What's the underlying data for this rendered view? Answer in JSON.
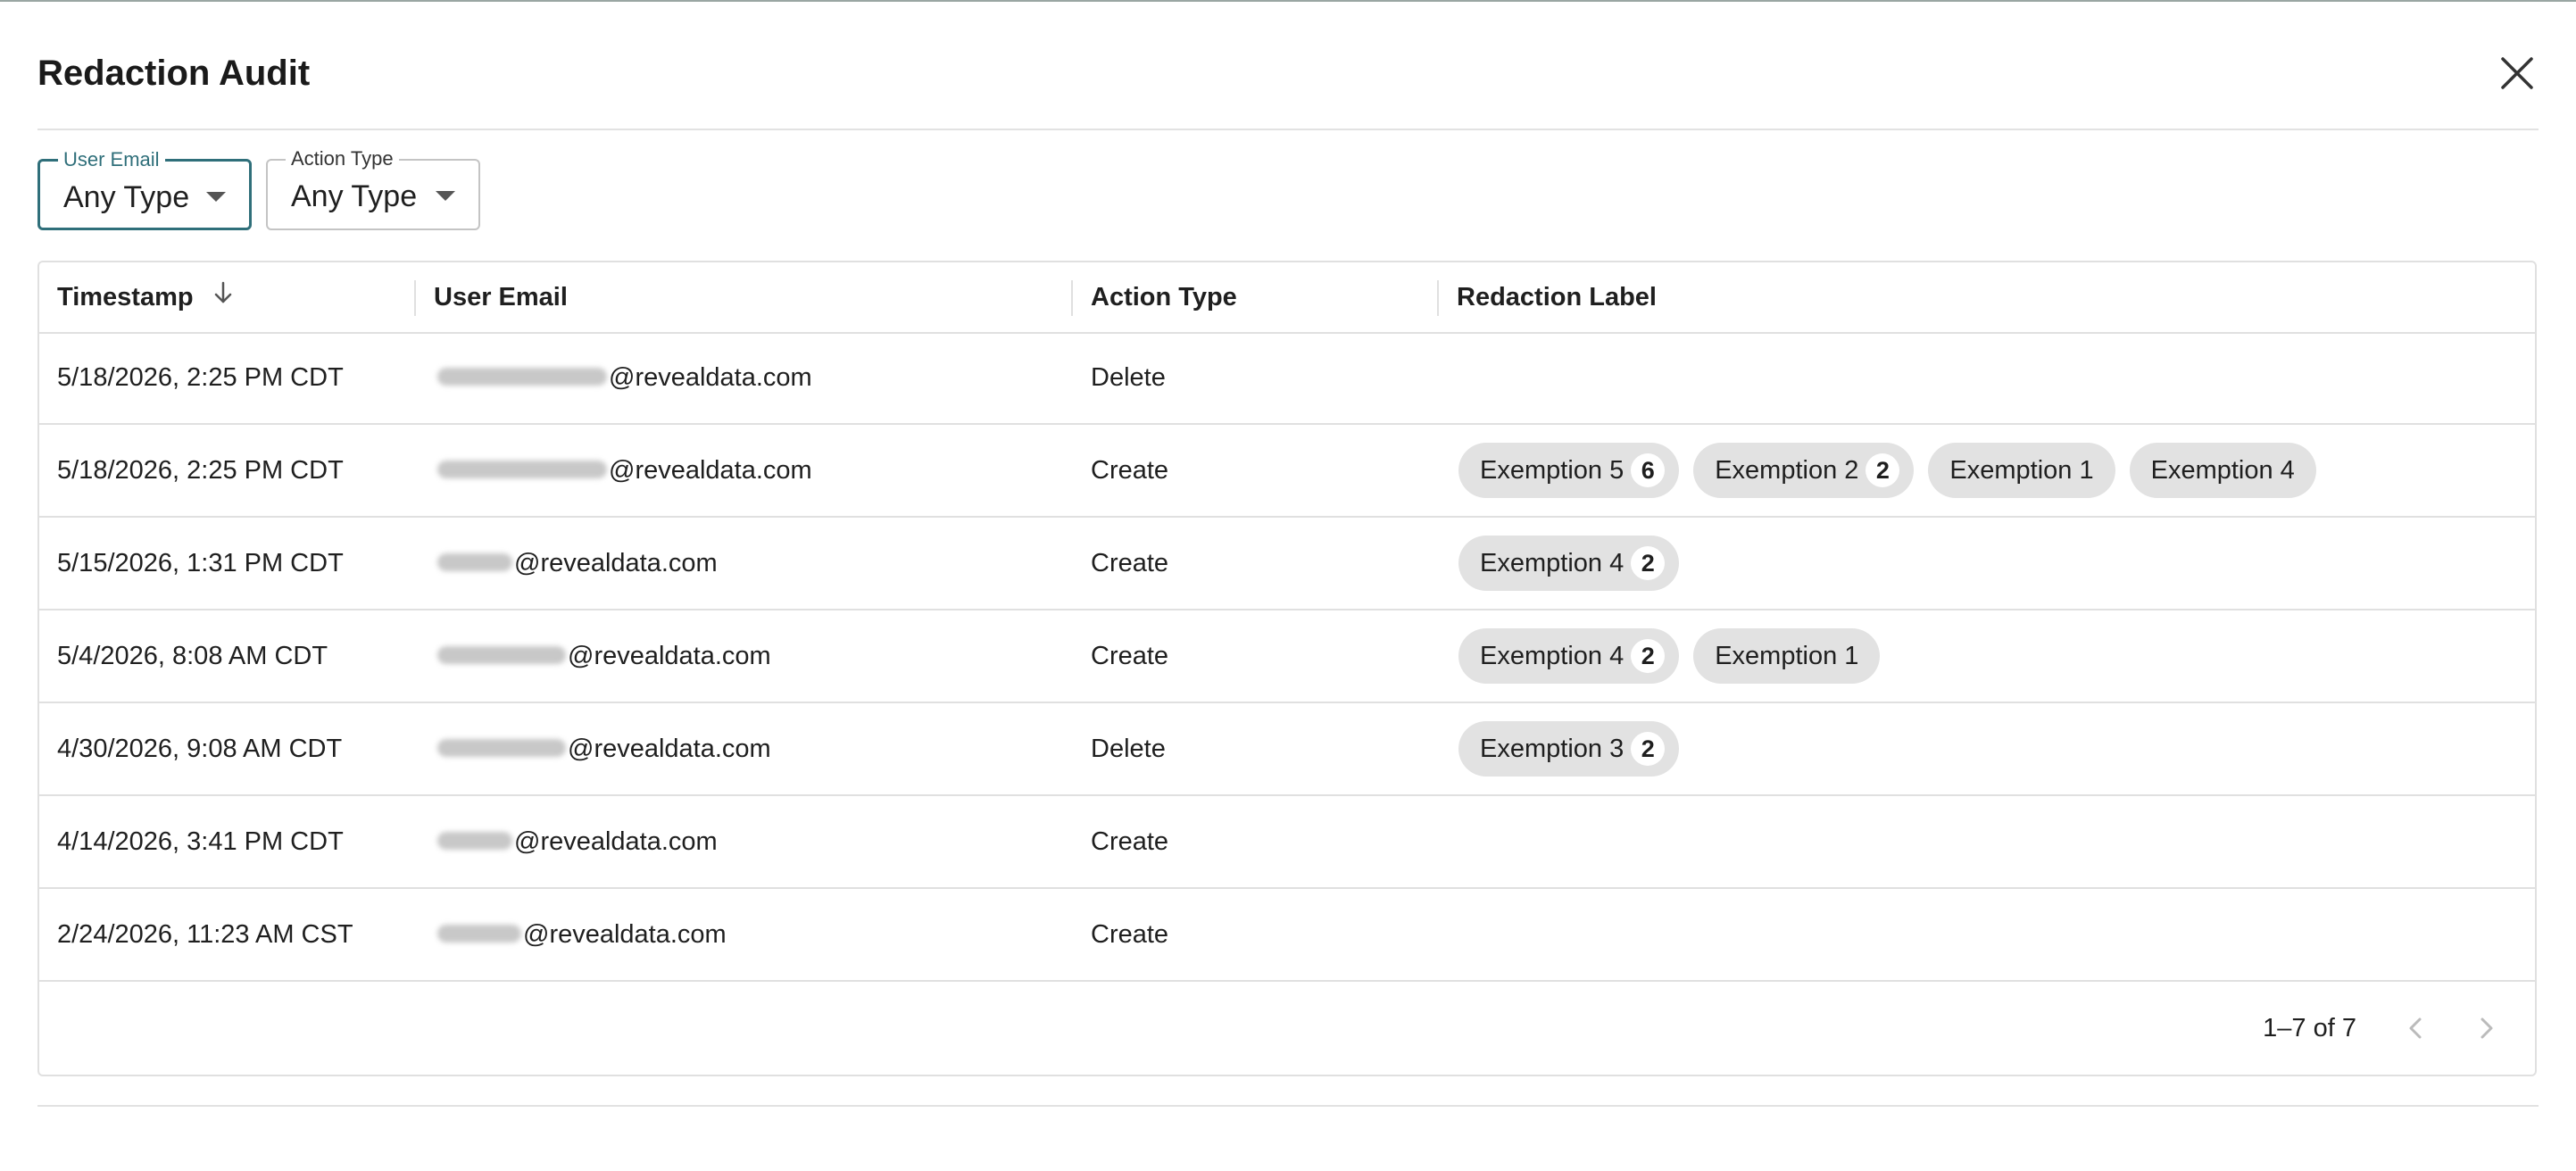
{
  "dialog": {
    "title": "Redaction Audit",
    "close_icon": "close-icon"
  },
  "filters": {
    "user_email": {
      "label": "User Email",
      "value": "Any Type"
    },
    "action_type": {
      "label": "Action Type",
      "value": "Any Type"
    }
  },
  "columns": {
    "timestamp": "Timestamp",
    "user_email": "User Email",
    "action_type": "Action Type",
    "redaction_label": "Redaction Label"
  },
  "rows": [
    {
      "timestamp": "5/18/2026, 2:25 PM CDT",
      "email_domain": "@revealdata.com",
      "action": "Delete",
      "labels": []
    },
    {
      "timestamp": "5/18/2026, 2:25 PM CDT",
      "email_domain": "@revealdata.com",
      "action": "Create",
      "labels": [
        {
          "text": "Exemption 5",
          "count": "6"
        },
        {
          "text": "Exemption 2",
          "count": "2"
        },
        {
          "text": "Exemption 1",
          "count": ""
        },
        {
          "text": "Exemption 4",
          "count": ""
        }
      ]
    },
    {
      "timestamp": "5/15/2026, 1:31 PM CDT",
      "email_domain": "@revealdata.com",
      "action": "Create",
      "labels": [
        {
          "text": "Exemption 4",
          "count": "2"
        }
      ]
    },
    {
      "timestamp": "5/4/2026, 8:08 AM CDT",
      "email_domain": "@revealdata.com",
      "action": "Create",
      "labels": [
        {
          "text": "Exemption 4",
          "count": "2"
        },
        {
          "text": "Exemption 1",
          "count": ""
        }
      ]
    },
    {
      "timestamp": "4/30/2026, 9:08 AM CDT",
      "email_domain": "@revealdata.com",
      "action": "Delete",
      "labels": [
        {
          "text": "Exemption 3",
          "count": "2"
        }
      ]
    },
    {
      "timestamp": "4/14/2026, 3:41 PM CDT",
      "email_domain": "@revealdata.com",
      "action": "Create",
      "labels": []
    },
    {
      "timestamp": "2/24/2026, 11:23 AM CST",
      "email_domain": "@revealdata.com",
      "action": "Create",
      "labels": []
    }
  ],
  "pagination": {
    "range": "1–7 of 7"
  },
  "colors": {
    "accent": "#2f6f7a",
    "chip_bg": "#e2e2e2",
    "border": "#e0e0e0"
  }
}
